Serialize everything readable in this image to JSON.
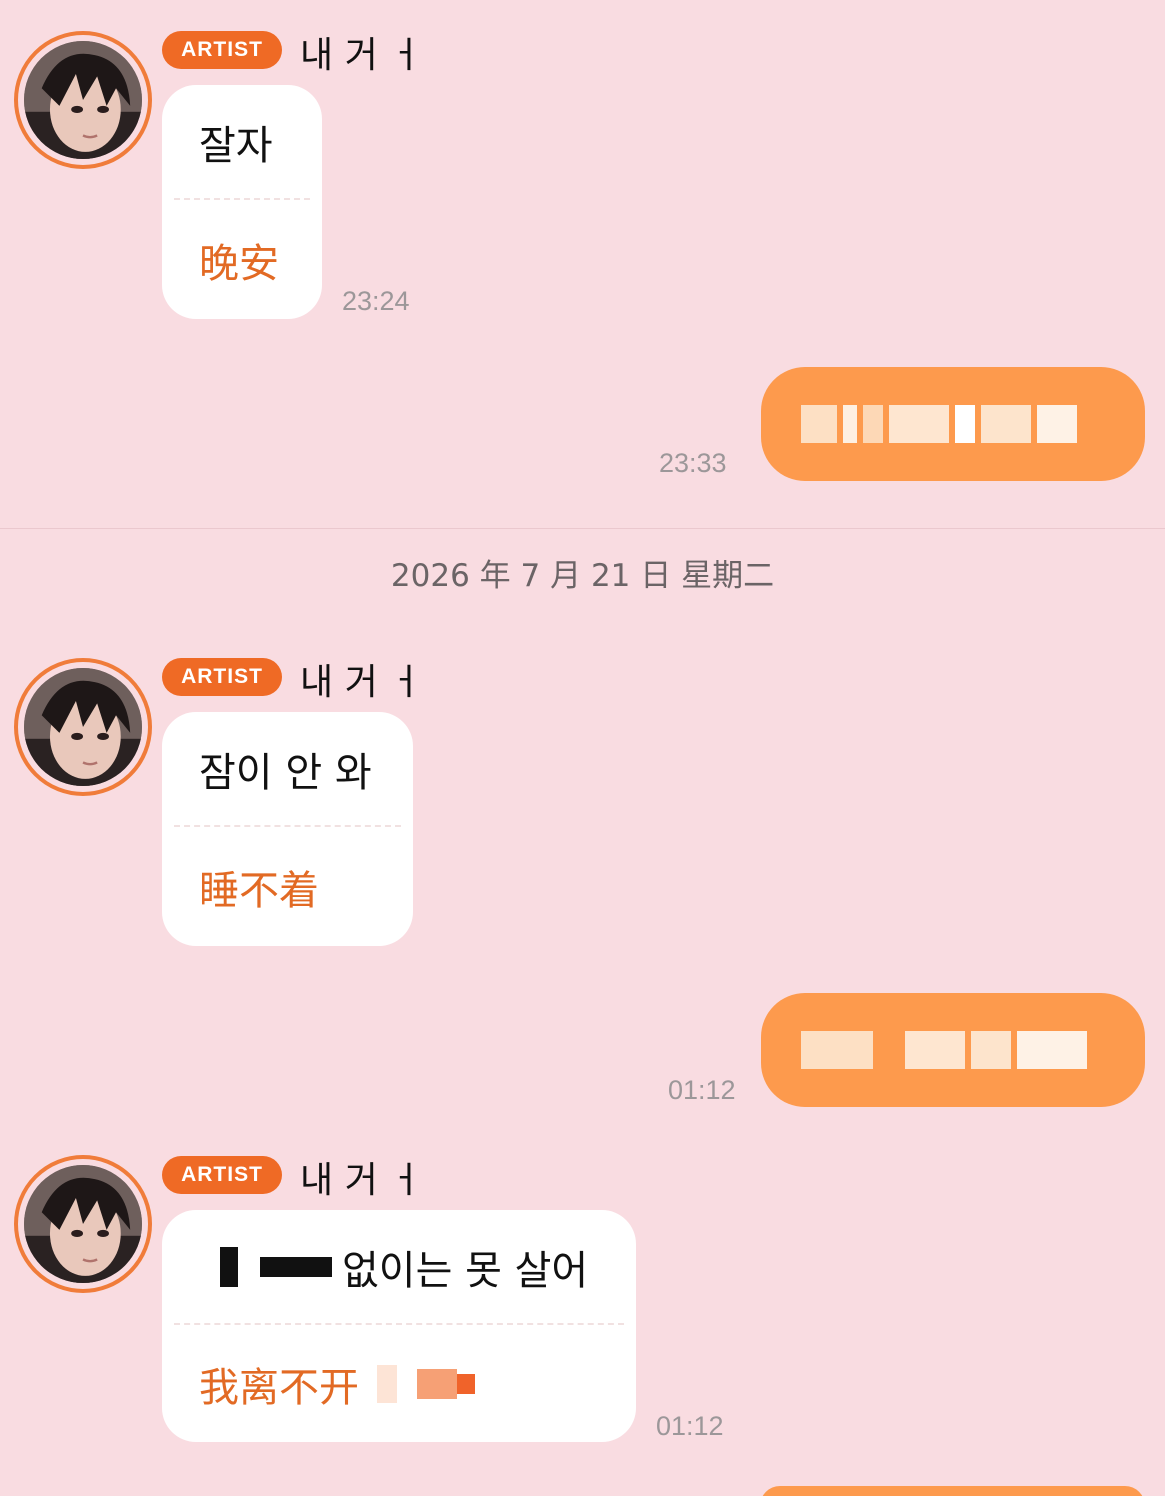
{
  "messages": [
    {
      "badge": "ARTIST",
      "sender": "내 거 ㅓ",
      "original": "잘자",
      "translation": "晚安",
      "time": "23:24"
    },
    {
      "mine_time": "23:33"
    },
    {
      "badge": "ARTIST",
      "sender": "내 거 ㅓ",
      "original": "잠이 안 와",
      "translation": "睡不着"
    },
    {
      "mine_time": "01:12"
    },
    {
      "badge": "ARTIST",
      "sender": "내 거 ㅓ",
      "original_suffix": "없이는 못 살어",
      "translation_prefix": "我离不开",
      "time": "01:12"
    }
  ],
  "date_separator": "2026 年 7 月 21 日  星期二",
  "colors": {
    "background": "#f9dce1",
    "accent": "#ef6a25",
    "my_bubble": "#fd9a4d",
    "translation_text": "#e26a24"
  },
  "icons": {
    "avatar": "artist-avatar-photo"
  }
}
